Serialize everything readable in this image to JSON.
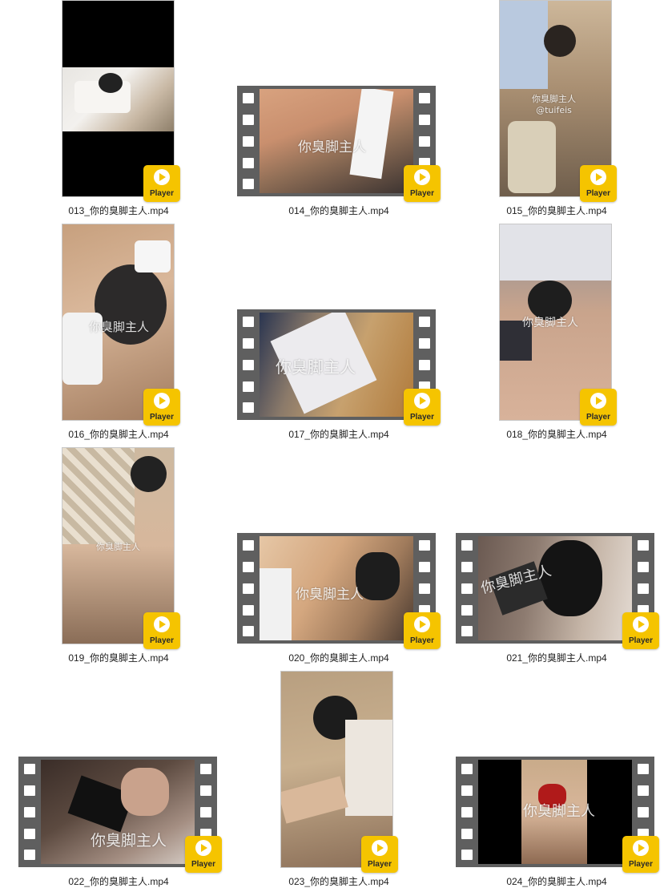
{
  "player_label": "Player",
  "files": [
    {
      "name": "013_你的臭脚主人.mp4",
      "watermark": ""
    },
    {
      "name": "014_你的臭脚主人.mp4",
      "watermark": "你臭脚主人"
    },
    {
      "name": "015_你的臭脚主人.mp4",
      "watermark": "你臭脚主人\n@tuifeis"
    },
    {
      "name": "016_你的臭脚主人.mp4",
      "watermark": "你臭脚主人"
    },
    {
      "name": "017_你的臭脚主人.mp4",
      "watermark": "你臭脚主人"
    },
    {
      "name": "018_你的臭脚主人.mp4",
      "watermark": "你臭脚主人"
    },
    {
      "name": "019_你的臭脚主人.mp4",
      "watermark": "你臭脚主人"
    },
    {
      "name": "020_你的臭脚主人.mp4",
      "watermark": "你臭脚主人"
    },
    {
      "name": "021_你的臭脚主人.mp4",
      "watermark": "你臭脚主人"
    },
    {
      "name": "022_你的臭脚主人.mp4",
      "watermark": "你臭脚主人"
    },
    {
      "name": "023_你的臭脚主人.mp4",
      "watermark": ""
    },
    {
      "name": "024_你的臭脚主人.mp4",
      "watermark": "你臭脚主人"
    }
  ]
}
